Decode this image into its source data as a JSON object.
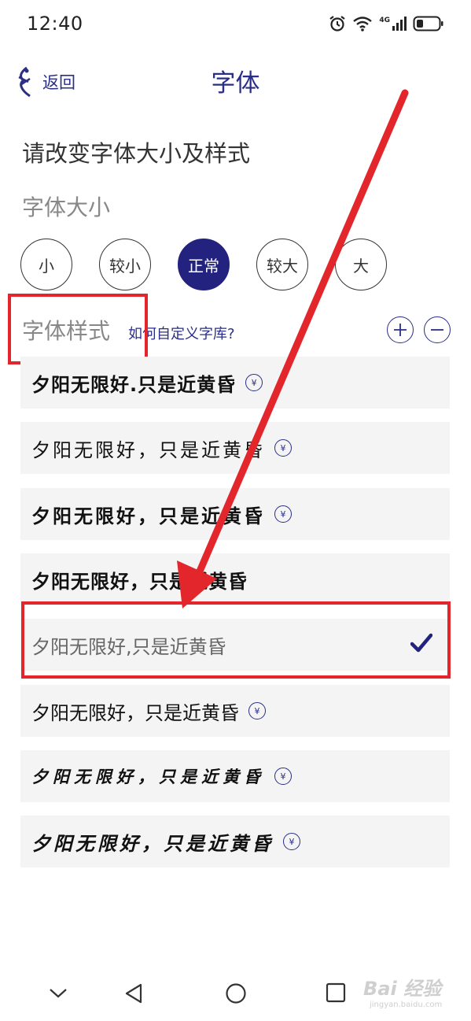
{
  "status_bar": {
    "time": "12:40",
    "icons": [
      "alarm-icon",
      "wifi-icon",
      "signal-4g-icon",
      "battery-icon"
    ],
    "network_label": "4G"
  },
  "header": {
    "back_label": "返回",
    "title": "字体"
  },
  "subtitle": "请改变字体大小及样式",
  "font_size": {
    "heading": "字体大小",
    "options": [
      "小",
      "较小",
      "正常",
      "较大",
      "大"
    ],
    "selected": "正常"
  },
  "font_style": {
    "heading": "字体样式",
    "custom_link": "如何自定义字库?",
    "items": [
      {
        "text": "夕阳无限好.只是近黄昏",
        "vip": true,
        "selected": false
      },
      {
        "text": "夕阳无限好，只是近黄昏",
        "vip": true,
        "selected": false
      },
      {
        "text": "夕阳无限好，只是近黄昏",
        "vip": true,
        "selected": false
      },
      {
        "text": "夕阳无限好，只是近黄昏",
        "vip": false,
        "selected": false
      },
      {
        "text": "夕阳无限好,只是近黄昏",
        "vip": false,
        "selected": true
      },
      {
        "text": "夕阳无限好，只是近黄昏",
        "vip": true,
        "selected": false
      },
      {
        "text": "夕阳无限好，只是近黄昏",
        "vip": true,
        "selected": false
      },
      {
        "text": "夕阳无限好，只是近黄昏",
        "vip": true,
        "selected": false
      }
    ],
    "vip_symbol": "¥"
  },
  "watermark": {
    "brand": "Bai 经验",
    "url": "jingyan.baidu.com"
  },
  "colors": {
    "accent": "#2a2e86",
    "selected_fill": "#23237f",
    "highlight_red": "#e3262c"
  }
}
